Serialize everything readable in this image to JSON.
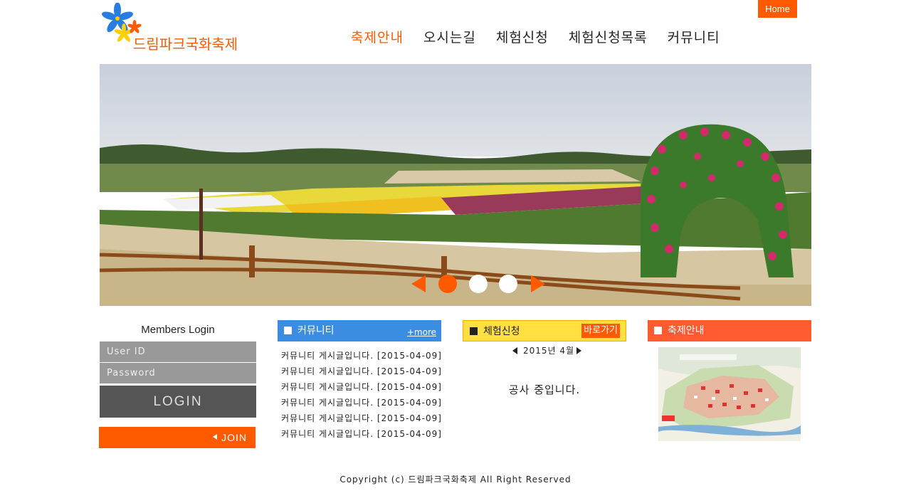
{
  "header": {
    "home_label": "Home",
    "logo_text": "드림파크국화축제"
  },
  "nav": {
    "items": [
      {
        "label": "축제안내",
        "active": true
      },
      {
        "label": "오시는길",
        "active": false
      },
      {
        "label": "체험신청",
        "active": false
      },
      {
        "label": "체험신청목록",
        "active": false
      },
      {
        "label": "커뮤니티",
        "active": false
      }
    ]
  },
  "slider": {
    "slide_count": 3,
    "active_slide": 1
  },
  "login": {
    "title": "Members Login",
    "userid_placeholder": "User ID",
    "password_placeholder": "Password",
    "login_label": "LOGIN",
    "join_label": "JOIN"
  },
  "community": {
    "title": "커뮤니티",
    "more_label": "+more",
    "posts": [
      "커뮤니티 게시글입니다. [2015-04-09]",
      "커뮤니티 게시글입니다. [2015-04-09]",
      "커뮤니티 게시글입니다. [2015-04-09]",
      "커뮤니티 게시글입니다. [2015-04-09]",
      "커뮤니티 게시글입니다. [2015-04-09]",
      "커뮤니티 게시글입니다. [2015-04-09]"
    ]
  },
  "experience": {
    "title": "체험신청",
    "go_label": "바로가기",
    "calendar_label": "2015년 4월",
    "notice": "공사 중입니다."
  },
  "festival": {
    "title": "축제안내"
  },
  "footer": {
    "copyright": "Copyright (c) 드림파크국화축제 All Right Reserved"
  },
  "colors": {
    "accent": "#ff5a00",
    "community_header": "#3a8de0",
    "experience_header": "#ffe040",
    "festival_header": "#ff5a30",
    "login_input": "#999999",
    "login_button": "#555555"
  }
}
